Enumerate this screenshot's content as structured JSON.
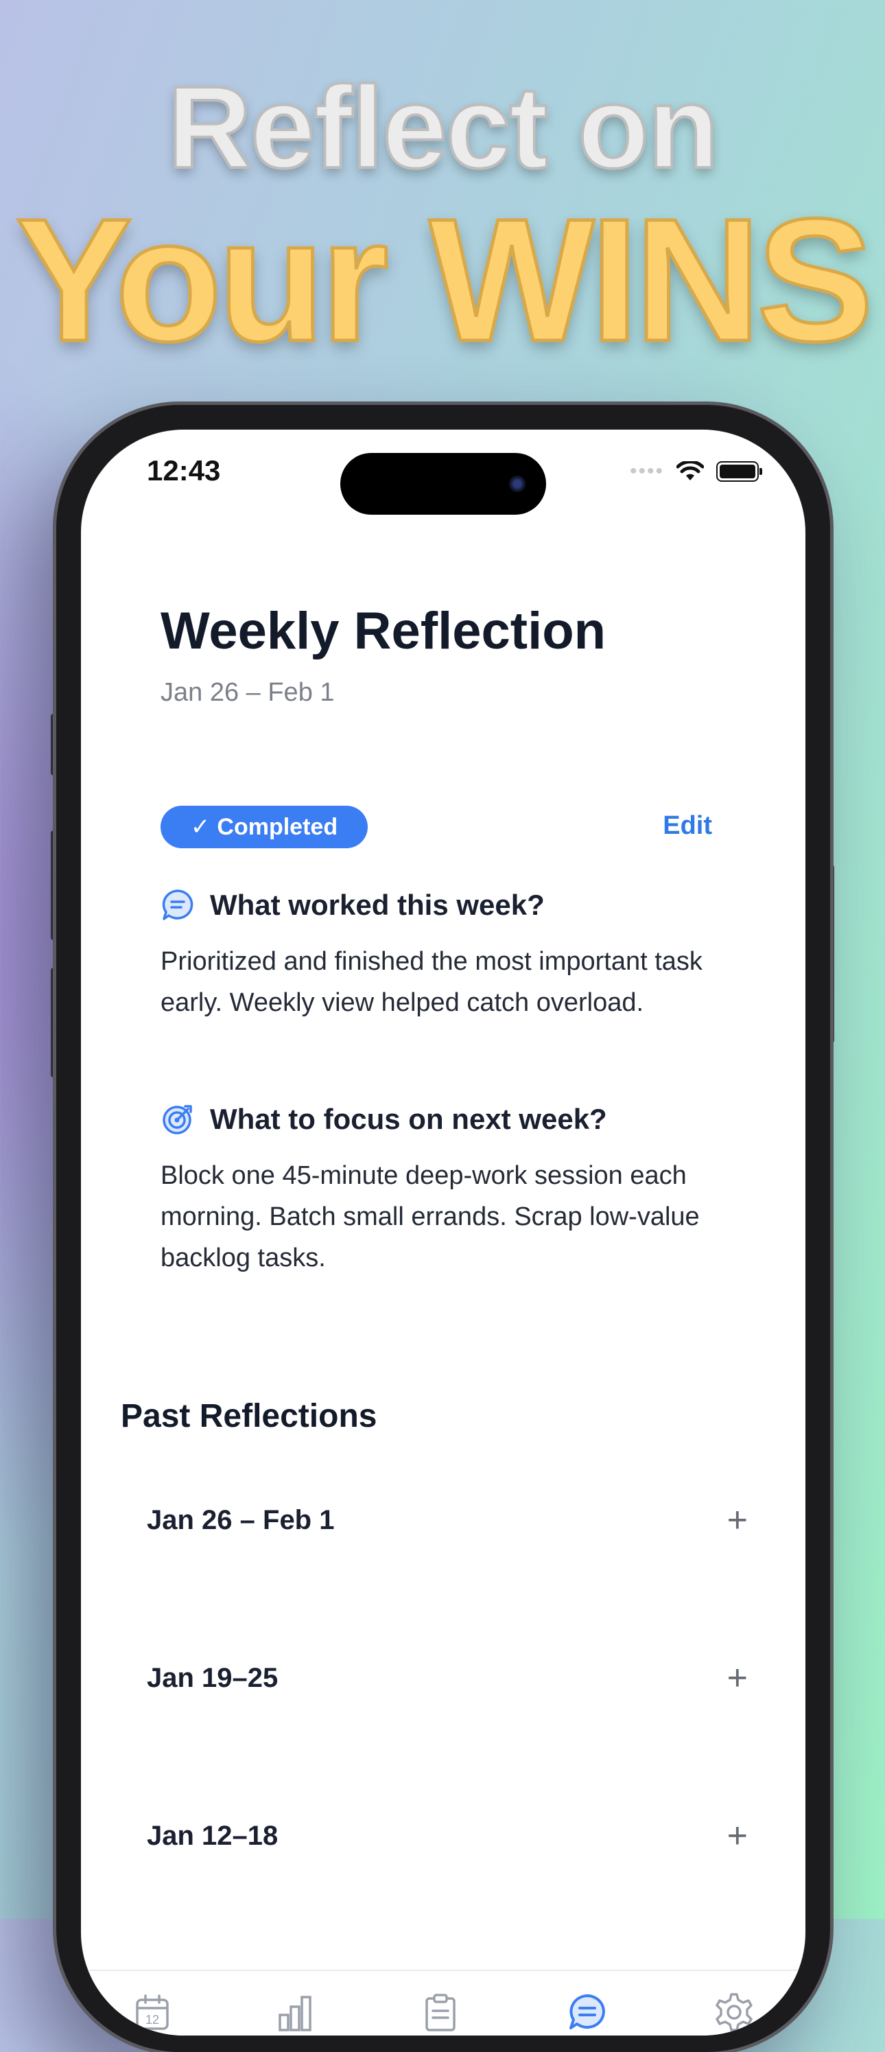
{
  "promo": {
    "line1": "Reflect on",
    "line2": "Your WINS"
  },
  "status_bar": {
    "time": "12:43"
  },
  "reflection": {
    "title": "Weekly Reflection",
    "date_range": "Jan 26 – Feb 1",
    "status_badge": "Completed",
    "badge_check": "✓",
    "edit_label": "Edit",
    "q1": {
      "question": "What worked this week?",
      "icon": "chat-bubble-icon",
      "answer": "Prioritized and finished the most important task early. Weekly view helped catch overload."
    },
    "q2": {
      "question": "What to focus on next week?",
      "icon": "target-icon",
      "answer": "Block one 45-minute deep-work session each morning. Batch small errands. Scrap low-value backlog tasks."
    }
  },
  "past": {
    "title": "Past Reflections",
    "items": [
      {
        "label": "Jan 26 – Feb 1",
        "action": "+"
      },
      {
        "label": "Jan 19–25",
        "action": "+"
      },
      {
        "label": "Jan 12–18",
        "action": "+"
      }
    ]
  },
  "tabbar": {
    "calendar_day": "12",
    "tabs": [
      {
        "icon": "calendar-icon",
        "active": false
      },
      {
        "icon": "bar-chart-icon",
        "active": false
      },
      {
        "icon": "clipboard-icon",
        "active": false
      },
      {
        "icon": "chat-bubble-icon",
        "active": true
      },
      {
        "icon": "gear-icon",
        "active": false
      }
    ]
  },
  "colors": {
    "accent": "#3b7df2",
    "headline_gold": "#fdd170",
    "headline_silver": "#ececec"
  }
}
